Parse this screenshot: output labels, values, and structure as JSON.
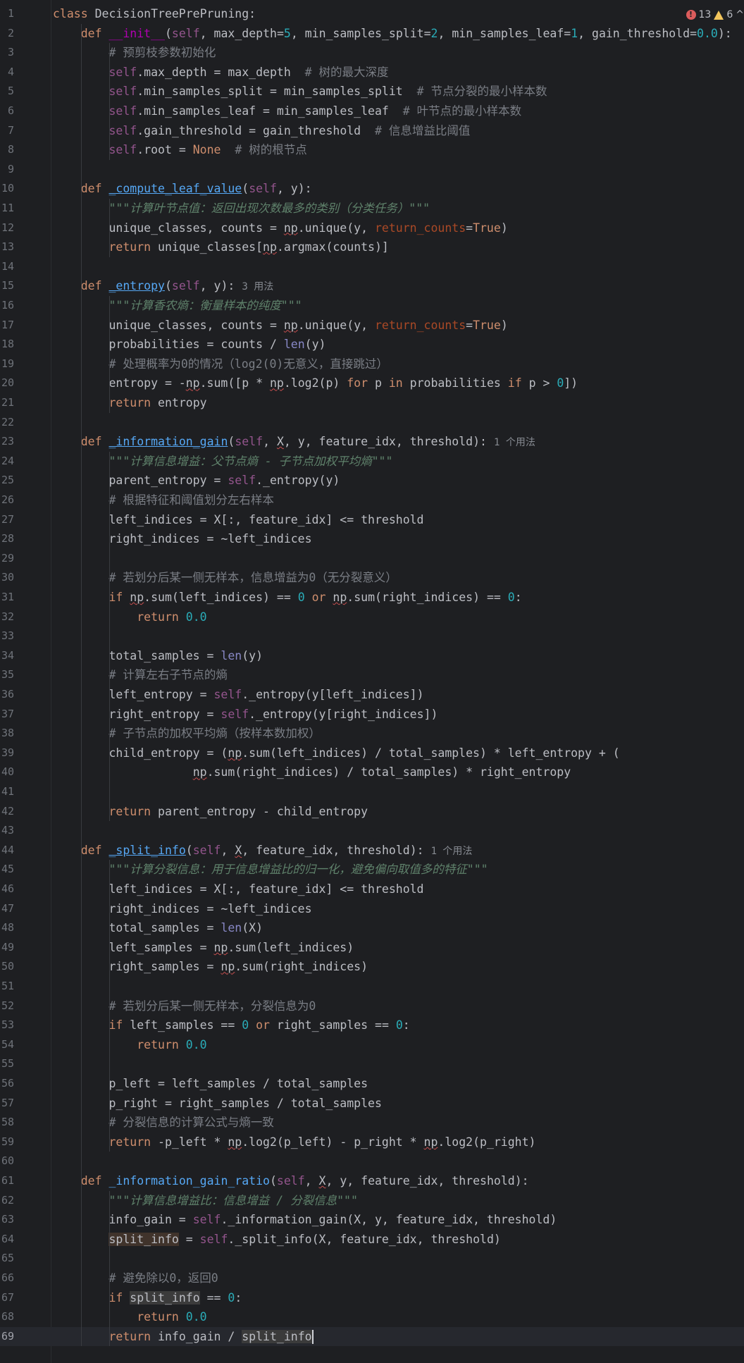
{
  "inspections": {
    "errors": "13",
    "warnings": "6",
    "chevron": "^"
  },
  "lines": [
    {
      "n": "1",
      "s": [
        [
          "kw",
          "class"
        ],
        [
          "",
          " DecisionTreePrePruning:"
        ]
      ]
    },
    {
      "n": "2",
      "s": [
        [
          "",
          "    "
        ],
        [
          "kw",
          "def"
        ],
        [
          "",
          " "
        ],
        [
          "dund",
          "__init__"
        ],
        [
          "",
          "("
        ],
        [
          "self",
          "self"
        ],
        [
          "",
          ", max_depth="
        ],
        [
          "num",
          "5"
        ],
        [
          "",
          ", min_samples_split="
        ],
        [
          "num",
          "2"
        ],
        [
          "",
          ", min_samples_leaf="
        ],
        [
          "num",
          "1"
        ],
        [
          "",
          ", gain_threshold="
        ],
        [
          "num",
          "0.0"
        ],
        [
          "",
          "):"
        ]
      ]
    },
    {
      "n": "3",
      "s": [
        [
          "",
          "        "
        ],
        [
          "cmt",
          "# 预剪枝参数初始化"
        ]
      ]
    },
    {
      "n": "4",
      "s": [
        [
          "",
          "        "
        ],
        [
          "self",
          "self"
        ],
        [
          "",
          ".max_depth = max_depth  "
        ],
        [
          "cmt",
          "# 树的最大深度"
        ]
      ]
    },
    {
      "n": "5",
      "s": [
        [
          "",
          "        "
        ],
        [
          "self",
          "self"
        ],
        [
          "",
          ".min_samples_split = min_samples_split  "
        ],
        [
          "cmt",
          "# 节点分裂的最小样本数"
        ]
      ]
    },
    {
      "n": "6",
      "s": [
        [
          "",
          "        "
        ],
        [
          "self",
          "self"
        ],
        [
          "",
          ".min_samples_leaf = min_samples_leaf  "
        ],
        [
          "cmt",
          "# 叶节点的最小样本数"
        ]
      ]
    },
    {
      "n": "7",
      "s": [
        [
          "",
          "        "
        ],
        [
          "self",
          "self"
        ],
        [
          "",
          ".gain_threshold = gain_threshold  "
        ],
        [
          "cmt",
          "# 信息增益比阈值"
        ]
      ]
    },
    {
      "n": "8",
      "s": [
        [
          "",
          "        "
        ],
        [
          "self",
          "self"
        ],
        [
          "",
          ".root = "
        ],
        [
          "kw",
          "None"
        ],
        [
          "",
          "  "
        ],
        [
          "cmt",
          "# 树的根节点"
        ]
      ]
    },
    {
      "n": "9",
      "s": []
    },
    {
      "n": "10",
      "s": [
        [
          "",
          "    "
        ],
        [
          "kw",
          "def"
        ],
        [
          "",
          " "
        ],
        [
          "fn usage",
          "_compute_leaf_value"
        ],
        [
          "",
          "("
        ],
        [
          "self",
          "self"
        ],
        [
          "",
          ", y):"
        ]
      ]
    },
    {
      "n": "11",
      "s": [
        [
          "",
          "        "
        ],
        [
          "doc",
          "\"\"\"计算叶节点值：返回出现次数最多的类别（分类任务）\"\"\""
        ]
      ]
    },
    {
      "n": "12",
      "s": [
        [
          "",
          "        unique_classes, counts = "
        ],
        [
          "uline",
          "np"
        ],
        [
          "",
          ".unique(y, "
        ],
        [
          "kwarg",
          "return_counts"
        ],
        [
          "",
          "="
        ],
        [
          "kw",
          "True"
        ],
        [
          "",
          ")"
        ]
      ]
    },
    {
      "n": "13",
      "s": [
        [
          "",
          "        "
        ],
        [
          "kw",
          "return"
        ],
        [
          "",
          " unique_classes["
        ],
        [
          "uline",
          "np"
        ],
        [
          "",
          ".argmax(counts)]"
        ]
      ]
    },
    {
      "n": "14",
      "s": []
    },
    {
      "n": "15",
      "s": [
        [
          "",
          "    "
        ],
        [
          "kw",
          "def"
        ],
        [
          "",
          " "
        ],
        [
          "fn usage",
          "_entropy"
        ],
        [
          "",
          "("
        ],
        [
          "self",
          "self"
        ],
        [
          "",
          ", y):"
        ],
        [
          "hint",
          "3 用法"
        ]
      ]
    },
    {
      "n": "16",
      "s": [
        [
          "",
          "        "
        ],
        [
          "doc",
          "\"\"\"计算香农熵：衡量样本的纯度\"\"\""
        ]
      ]
    },
    {
      "n": "17",
      "s": [
        [
          "",
          "        unique_classes, counts = "
        ],
        [
          "uline",
          "np"
        ],
        [
          "",
          ".unique(y, "
        ],
        [
          "kwarg",
          "return_counts"
        ],
        [
          "",
          "="
        ],
        [
          "kw",
          "True"
        ],
        [
          "",
          ")"
        ]
      ]
    },
    {
      "n": "18",
      "s": [
        [
          "",
          "        probabilities = counts / "
        ],
        [
          "bi",
          "len"
        ],
        [
          "",
          "(y)"
        ]
      ]
    },
    {
      "n": "19",
      "s": [
        [
          "",
          "        "
        ],
        [
          "cmt",
          "# 处理概率为0的情况（log2(0)无意义，直接跳过）"
        ]
      ]
    },
    {
      "n": "20",
      "s": [
        [
          "",
          "        entropy = -"
        ],
        [
          "uline",
          "np"
        ],
        [
          "",
          ".sum([p * "
        ],
        [
          "uline",
          "np"
        ],
        [
          "",
          ".log2(p) "
        ],
        [
          "kw",
          "for"
        ],
        [
          "",
          " p "
        ],
        [
          "kw",
          "in"
        ],
        [
          "",
          " probabilities "
        ],
        [
          "kw",
          "if"
        ],
        [
          "",
          " p > "
        ],
        [
          "num",
          "0"
        ],
        [
          "",
          "])"
        ]
      ]
    },
    {
      "n": "21",
      "s": [
        [
          "",
          "        "
        ],
        [
          "kw",
          "return"
        ],
        [
          "",
          " entropy"
        ]
      ]
    },
    {
      "n": "22",
      "s": []
    },
    {
      "n": "23",
      "s": [
        [
          "",
          "    "
        ],
        [
          "kw",
          "def"
        ],
        [
          "",
          " "
        ],
        [
          "fn usage",
          "_information_gain"
        ],
        [
          "",
          "("
        ],
        [
          "self",
          "self"
        ],
        [
          "",
          ", "
        ],
        [
          "uline",
          "X"
        ],
        [
          "",
          ", y, feature_idx, threshold):"
        ],
        [
          "hint",
          "1 个用法"
        ]
      ]
    },
    {
      "n": "24",
      "s": [
        [
          "",
          "        "
        ],
        [
          "doc",
          "\"\"\"计算信息增益：父节点熵 - 子节点加权平均熵\"\"\""
        ]
      ]
    },
    {
      "n": "25",
      "s": [
        [
          "",
          "        parent_entropy = "
        ],
        [
          "self",
          "self"
        ],
        [
          "",
          "._entropy(y)"
        ]
      ]
    },
    {
      "n": "26",
      "s": [
        [
          "",
          "        "
        ],
        [
          "cmt",
          "# 根据特征和阈值划分左右样本"
        ]
      ]
    },
    {
      "n": "27",
      "s": [
        [
          "",
          "        left_indices = X[:, feature_idx] <= threshold"
        ]
      ]
    },
    {
      "n": "28",
      "s": [
        [
          "",
          "        right_indices = ~left_indices"
        ]
      ]
    },
    {
      "n": "29",
      "s": []
    },
    {
      "n": "30",
      "s": [
        [
          "",
          "        "
        ],
        [
          "cmt",
          "# 若划分后某一侧无样本，信息增益为0（无分裂意义）"
        ]
      ]
    },
    {
      "n": "31",
      "s": [
        [
          "",
          "        "
        ],
        [
          "kw",
          "if"
        ],
        [
          "",
          " "
        ],
        [
          "uline",
          "np"
        ],
        [
          "",
          ".sum(left_indices) == "
        ],
        [
          "num",
          "0"
        ],
        [
          "",
          " "
        ],
        [
          "kw",
          "or"
        ],
        [
          "",
          " "
        ],
        [
          "uline",
          "np"
        ],
        [
          "",
          ".sum(right_indices) == "
        ],
        [
          "num",
          "0"
        ],
        [
          "",
          ":"
        ]
      ]
    },
    {
      "n": "32",
      "s": [
        [
          "",
          "            "
        ],
        [
          "kw",
          "return"
        ],
        [
          "",
          " "
        ],
        [
          "num",
          "0.0"
        ]
      ]
    },
    {
      "n": "33",
      "s": []
    },
    {
      "n": "34",
      "s": [
        [
          "",
          "        total_samples = "
        ],
        [
          "bi",
          "len"
        ],
        [
          "",
          "(y)"
        ]
      ]
    },
    {
      "n": "35",
      "s": [
        [
          "",
          "        "
        ],
        [
          "cmt",
          "# 计算左右子节点的熵"
        ]
      ]
    },
    {
      "n": "36",
      "s": [
        [
          "",
          "        left_entropy = "
        ],
        [
          "self",
          "self"
        ],
        [
          "",
          "._entropy(y[left_indices])"
        ]
      ]
    },
    {
      "n": "37",
      "s": [
        [
          "",
          "        right_entropy = "
        ],
        [
          "self",
          "self"
        ],
        [
          "",
          "._entropy(y[right_indices])"
        ]
      ]
    },
    {
      "n": "38",
      "s": [
        [
          "",
          "        "
        ],
        [
          "cmt",
          "# 子节点的加权平均熵（按样本数加权）"
        ]
      ]
    },
    {
      "n": "39",
      "s": [
        [
          "",
          "        child_entropy = ("
        ],
        [
          "uline",
          "np"
        ],
        [
          "",
          ".sum(left_indices) / total_samples) * left_entropy + ("
        ]
      ]
    },
    {
      "n": "40",
      "s": [
        [
          "",
          "                    "
        ],
        [
          "uline",
          "np"
        ],
        [
          "",
          ".sum(right_indices) / total_samples) * right_entropy"
        ]
      ]
    },
    {
      "n": "41",
      "s": []
    },
    {
      "n": "42",
      "s": [
        [
          "",
          "        "
        ],
        [
          "kw",
          "return"
        ],
        [
          "",
          " parent_entropy - child_entropy"
        ]
      ]
    },
    {
      "n": "43",
      "s": []
    },
    {
      "n": "44",
      "s": [
        [
          "",
          "    "
        ],
        [
          "kw",
          "def"
        ],
        [
          "",
          " "
        ],
        [
          "fn usage",
          "_split_info"
        ],
        [
          "",
          "("
        ],
        [
          "self",
          "self"
        ],
        [
          "",
          ", "
        ],
        [
          "uline",
          "X"
        ],
        [
          "",
          ", feature_idx, threshold):"
        ],
        [
          "hint",
          "1 个用法"
        ]
      ]
    },
    {
      "n": "45",
      "s": [
        [
          "",
          "        "
        ],
        [
          "doc",
          "\"\"\"计算分裂信息：用于信息增益比的归一化，避免偏向取值多的特征\"\"\""
        ]
      ]
    },
    {
      "n": "46",
      "s": [
        [
          "",
          "        left_indices = X[:, feature_idx] <= threshold"
        ]
      ]
    },
    {
      "n": "47",
      "s": [
        [
          "",
          "        right_indices = ~left_indices"
        ]
      ]
    },
    {
      "n": "48",
      "s": [
        [
          "",
          "        total_samples = "
        ],
        [
          "bi",
          "len"
        ],
        [
          "",
          "(X)"
        ]
      ]
    },
    {
      "n": "49",
      "s": [
        [
          "",
          "        left_samples = "
        ],
        [
          "uline",
          "np"
        ],
        [
          "",
          ".sum(left_indices)"
        ]
      ]
    },
    {
      "n": "50",
      "s": [
        [
          "",
          "        right_samples = "
        ],
        [
          "uline",
          "np"
        ],
        [
          "",
          ".sum(right_indices)"
        ]
      ]
    },
    {
      "n": "51",
      "s": []
    },
    {
      "n": "52",
      "s": [
        [
          "",
          "        "
        ],
        [
          "cmt",
          "# 若划分后某一侧无样本，分裂信息为0"
        ]
      ]
    },
    {
      "n": "53",
      "s": [
        [
          "",
          "        "
        ],
        [
          "kw",
          "if"
        ],
        [
          "",
          " left_samples == "
        ],
        [
          "num",
          "0"
        ],
        [
          "",
          " "
        ],
        [
          "kw",
          "or"
        ],
        [
          "",
          " right_samples == "
        ],
        [
          "num",
          "0"
        ],
        [
          "",
          ":"
        ]
      ]
    },
    {
      "n": "54",
      "s": [
        [
          "",
          "            "
        ],
        [
          "kw",
          "return"
        ],
        [
          "",
          " "
        ],
        [
          "num",
          "0.0"
        ]
      ]
    },
    {
      "n": "55",
      "s": []
    },
    {
      "n": "56",
      "s": [
        [
          "",
          "        p_left = left_samples / total_samples"
        ]
      ]
    },
    {
      "n": "57",
      "s": [
        [
          "",
          "        p_right = right_samples / total_samples"
        ]
      ]
    },
    {
      "n": "58",
      "s": [
        [
          "",
          "        "
        ],
        [
          "cmt",
          "# 分裂信息的计算公式与熵一致"
        ]
      ]
    },
    {
      "n": "59",
      "s": [
        [
          "",
          "        "
        ],
        [
          "kw",
          "return"
        ],
        [
          "",
          " -p_left * "
        ],
        [
          "uline",
          "np"
        ],
        [
          "",
          ".log2(p_left) - p_right * "
        ],
        [
          "uline",
          "np"
        ],
        [
          "",
          ".log2(p_right)"
        ]
      ]
    },
    {
      "n": "60",
      "s": []
    },
    {
      "n": "61",
      "s": [
        [
          "",
          "    "
        ],
        [
          "kw",
          "def"
        ],
        [
          "",
          " "
        ],
        [
          "fn",
          "_information_gain_ratio"
        ],
        [
          "",
          "("
        ],
        [
          "self",
          "self"
        ],
        [
          "",
          ", "
        ],
        [
          "uline",
          "X"
        ],
        [
          "",
          ", y, feature_idx, threshold):"
        ]
      ]
    },
    {
      "n": "62",
      "s": [
        [
          "",
          "        "
        ],
        [
          "doc",
          "\"\"\"计算信息增益比：信息增益 / 分裂信息\"\"\""
        ]
      ]
    },
    {
      "n": "63",
      "s": [
        [
          "",
          "        info_gain = "
        ],
        [
          "self",
          "self"
        ],
        [
          "",
          "._information_gain(X, y, feature_idx, threshold)"
        ]
      ]
    },
    {
      "n": "64",
      "s": [
        [
          "",
          "        "
        ],
        [
          "hlw",
          "split_info"
        ],
        [
          "",
          " = "
        ],
        [
          "self",
          "self"
        ],
        [
          "",
          "._split_info(X, feature_idx, threshold)"
        ]
      ]
    },
    {
      "n": "65",
      "s": []
    },
    {
      "n": "66",
      "s": [
        [
          "",
          "        "
        ],
        [
          "cmt",
          "# 避免除以0，返回0"
        ]
      ]
    },
    {
      "n": "67",
      "s": [
        [
          "",
          "        "
        ],
        [
          "kw",
          "if"
        ],
        [
          "",
          " "
        ],
        [
          "hl",
          "split_info"
        ],
        [
          "",
          " == "
        ],
        [
          "num",
          "0"
        ],
        [
          "",
          ":"
        ]
      ]
    },
    {
      "n": "68",
      "s": [
        [
          "",
          "            "
        ],
        [
          "kw",
          "return"
        ],
        [
          "",
          " "
        ],
        [
          "num",
          "0.0"
        ]
      ]
    },
    {
      "n": "69",
      "s": [
        [
          "",
          "        "
        ],
        [
          "kw",
          "return"
        ],
        [
          "",
          " info_gain / "
        ],
        [
          "hl",
          "split_info"
        ],
        [
          "caret",
          ""
        ]
      ]
    }
  ]
}
